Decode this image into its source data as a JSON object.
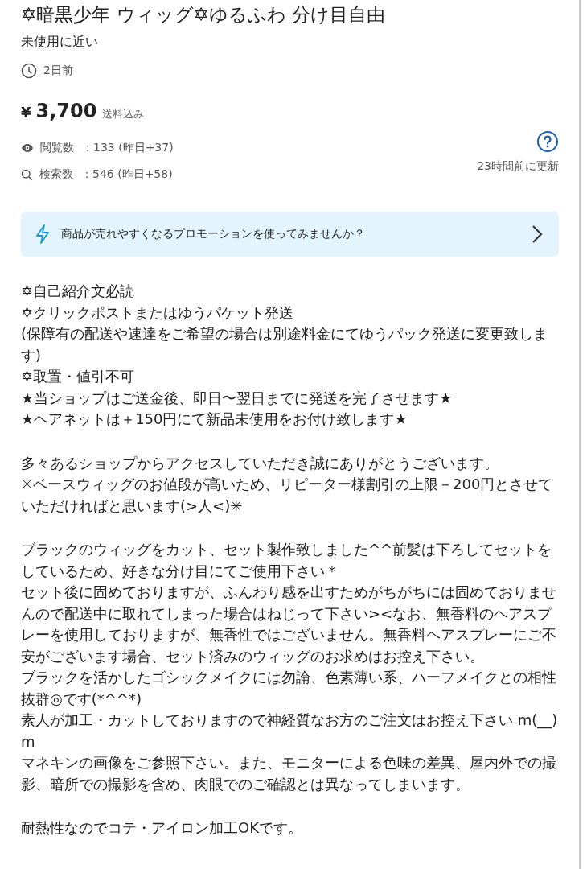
{
  "title": "✡暗黒少年 ウィッグ✡ゆるふわ 分け目自由",
  "condition": "未使用に近い",
  "posted": "2日前",
  "price": {
    "currency": "¥",
    "amount": "3,700",
    "shipping": "送料込み"
  },
  "stats": [
    {
      "kind": "views",
      "label": "閲覧数",
      "value": "：133 (昨日+37)"
    },
    {
      "kind": "searches",
      "label": "検索数",
      "value": "：546 (昨日+58)"
    }
  ],
  "updated": "23時間前に更新",
  "promotion": {
    "text": "商品が売れやすくなるプロモーションを使ってみませんか？"
  },
  "description": [
    [
      "✡自己紹介文必読",
      "✡クリックポストまたはゆうパケット発送",
      "(保障有の配送や速達をご希望の場合は別途料金にてゆうパック発送に変更致します)",
      "✡取置・値引不可",
      "★当ショップはご送金後、即日〜翌日までに発送を完了させます★",
      "★ヘアネットは＋150円にて新品未使用をお付け致します★"
    ],
    [
      "多々あるショップからアクセスしていただき誠にありがとうございます。",
      "✳︎ベースウィッグのお値段が高いため、リピーター様割引の上限－200円とさせていただければと思います(>人<)✳︎"
    ],
    [
      "ブラックのウィッグをカット、セット製作致しました^^前髪は下ろしてセットをしているため、好きな分け目にてご使用下さい＊",
      "セット後に固めておりますが、ふんわり感を出すためがちがちには固めておりませんので配送中に取れてしまった場合はねじって下さい><なお、無香料のヘアスプレーを使用しておりますが、無香性ではございません。無香料ヘアスプレーにご不安がございます場合、セット済みのウィッグのお求めはお控え下さい。",
      "ブラックを活かしたゴシックメイクには勿論、色素薄い系、ハーフメイクとの相性抜群◎です(*^^*)",
      "素人が加工・カットしておりますので神経質なお方のご注文はお控え下さい m(__)m",
      "マネキンの画像をご参照下さい。また、モニターによる色味の差異、屋内外での撮影、暗所での撮影を含め、肉眼でのご確認とは異なってしまいます。"
    ],
    [
      "耐熱性なのでコテ・アイロン加工OKです。"
    ]
  ]
}
